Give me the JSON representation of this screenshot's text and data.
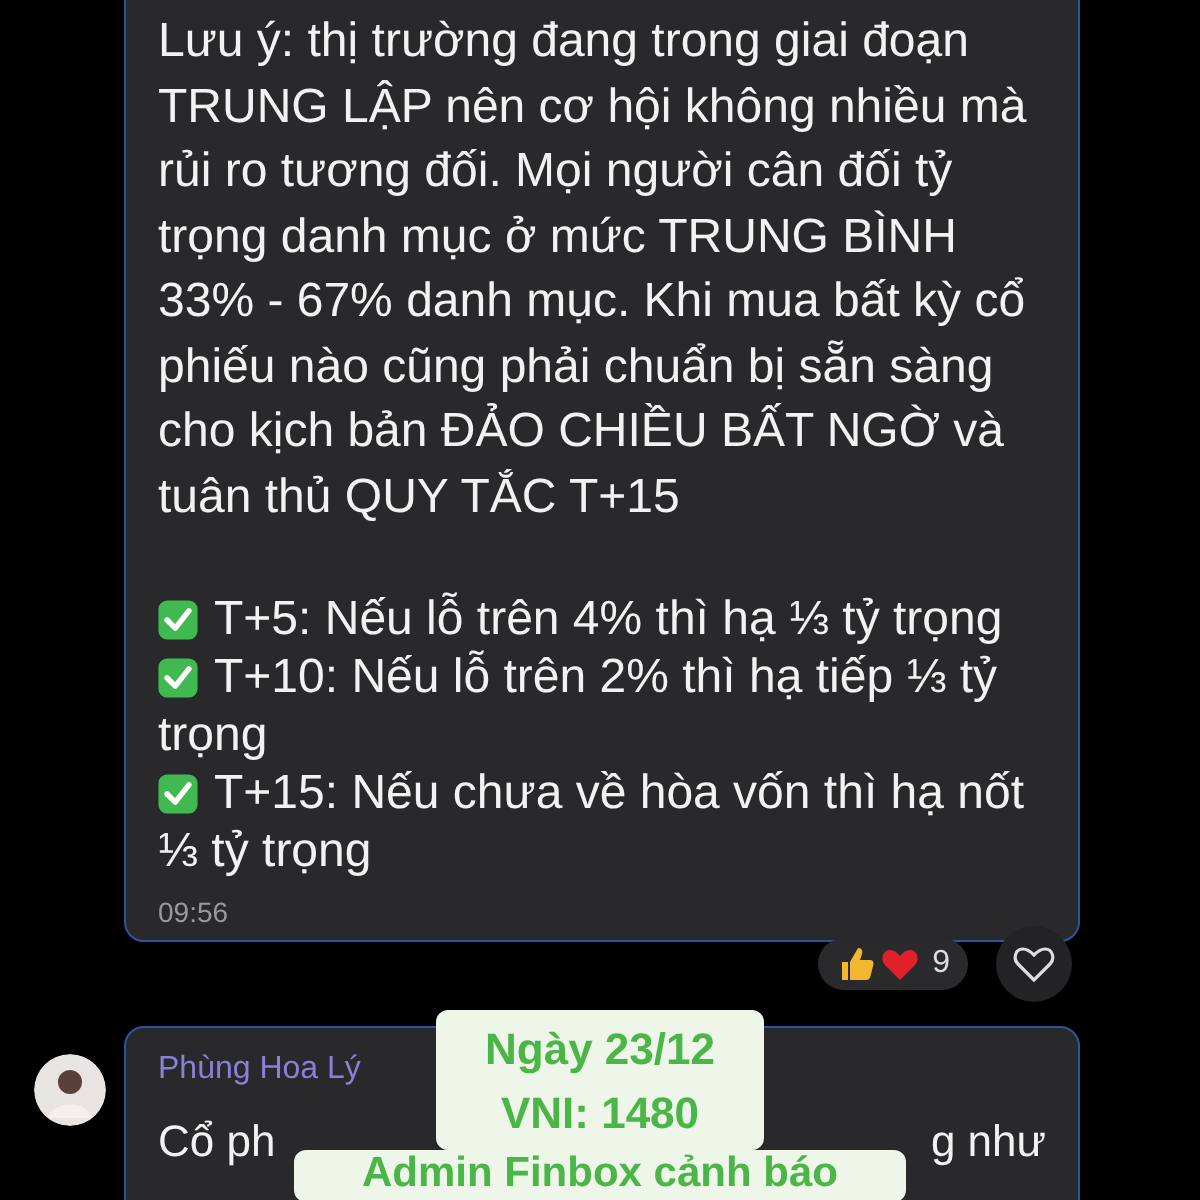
{
  "messages": [
    {
      "text": "Lưu ý: thị trường đang trong giai đoạn TRUNG LẬP nên cơ hội không nhiều mà rủi ro tương đối. Mọi người cân đối tỷ trọng danh mục ở mức TRUNG BÌNH 33% - 67% danh mục. Khi mua bất kỳ cổ phiếu nào cũng phải chuẩn bị sẵn sàng cho kịch bản ĐẢO CHIỀU BẤT NGỜ và tuân thủ QUY TẮC T+15",
      "checklist": [
        {
          "text": "T+5: Nếu lỗ trên 4% thì hạ ⅓ tỷ trọng",
          "checked": true
        },
        {
          "text": "T+10: Nếu lỗ trên 2% thì hạ tiếp ⅓ tỷ trọng",
          "checked": true
        },
        {
          "text": "T+15: Nếu chưa về hòa vốn thì hạ nốt ⅓ tỷ trọng",
          "checked": true
        }
      ],
      "time": "09:56",
      "reaction_count": "9",
      "liked": false
    },
    {
      "sender": "Phùng Hoa Lý",
      "text_start": "Cổ ph",
      "text_end": "g như"
    }
  ],
  "overlay": {
    "lines": [
      "Ngày 23/12",
      "VNI: 1480",
      "Admin Finbox cảnh báo"
    ]
  }
}
